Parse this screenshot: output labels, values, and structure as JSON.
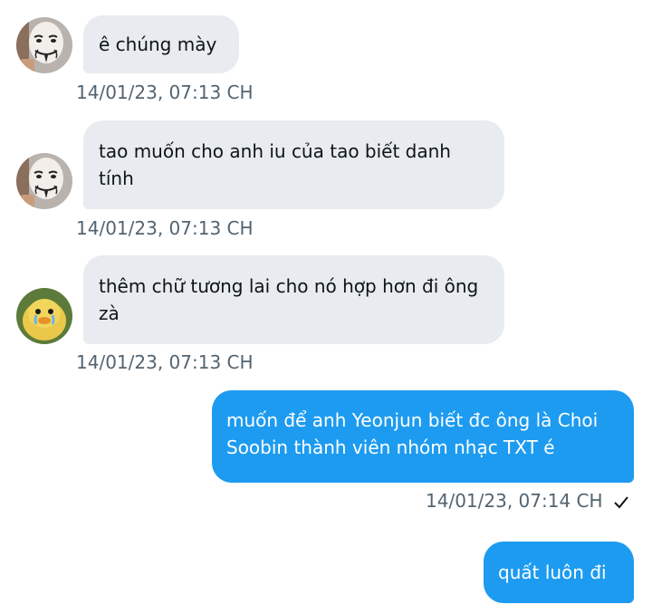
{
  "messages": [
    {
      "direction": "incoming",
      "avatar": "guy-fawkes-mask-avatar",
      "text": "ê chúng mày",
      "timestamp": "14/01/23,  07:13 CH"
    },
    {
      "direction": "incoming",
      "avatar": "guy-fawkes-mask-avatar",
      "text": "tao muốn cho anh iu của tao biết danh tính",
      "timestamp": "14/01/23,  07:13 CH"
    },
    {
      "direction": "incoming",
      "avatar": "crying-duck-avatar",
      "text": "thêm chữ tương lai cho nó hợp hơn đi ông zà",
      "timestamp": "14/01/23,  07:13 CH"
    },
    {
      "direction": "outgoing",
      "text": "muốn để anh Yeonjun biết đc ông là Choi Soobin thành viên nhóm nhạc TXT é",
      "timestamp": "14/01/23,  07:14 CH",
      "status_icon": "check-icon"
    },
    {
      "direction": "outgoing",
      "text": "quất luôn đi"
    }
  ],
  "colors": {
    "incoming_bubble": "#e8ecf0",
    "outgoing_bubble": "#1d9bf0",
    "timestamp": "#536471",
    "text": "#0f1419"
  }
}
